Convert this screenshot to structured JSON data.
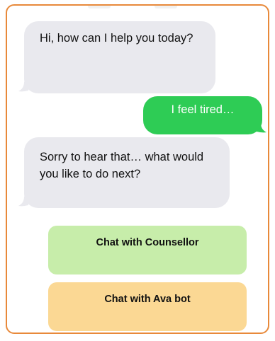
{
  "messages": [
    {
      "sender": "bot",
      "text": "Hi, how can I help you today?"
    },
    {
      "sender": "user",
      "text": "I feel tired…"
    },
    {
      "sender": "bot",
      "text": "Sorry to hear that… what would you like to do next?"
    }
  ],
  "choices": {
    "counsellor_label": "Chat with Counsellor",
    "ava_label": "Chat with Ava bot"
  },
  "colors": {
    "frame_border": "#e8893a",
    "incoming_bubble": "#e9e9ee",
    "outgoing_bubble": "#2ecc55",
    "counsellor_button": "#c7edaa",
    "ava_button": "#fbd894"
  }
}
